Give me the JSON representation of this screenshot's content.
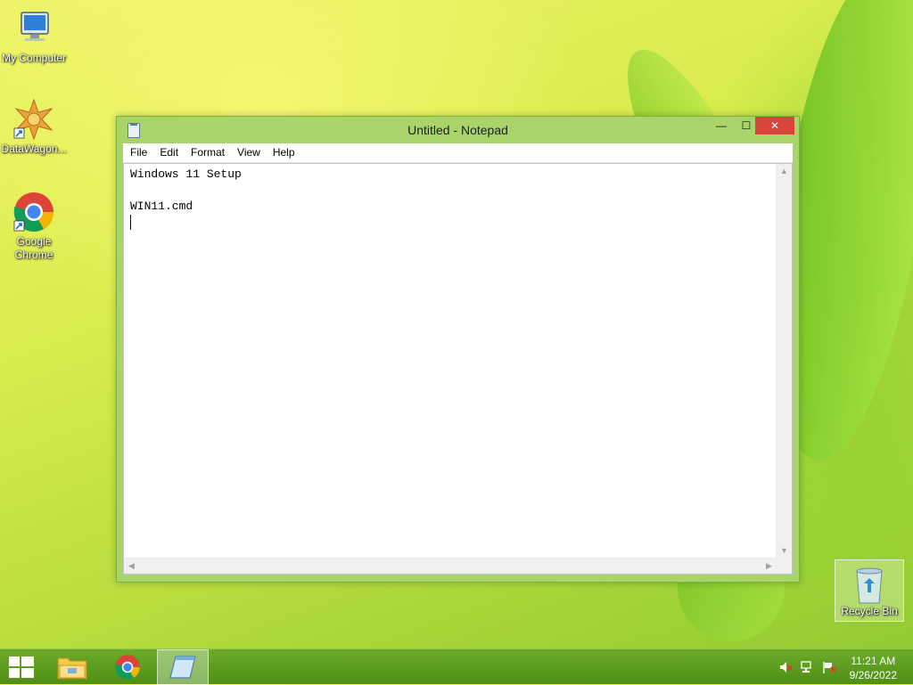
{
  "desktop": {
    "icons": [
      {
        "label": "My Computer"
      },
      {
        "label": "DataWagon..."
      },
      {
        "label": "Google Chrome"
      },
      {
        "label": "Recycle Bin"
      }
    ]
  },
  "window": {
    "title": "Untitled - Notepad",
    "controls": {
      "minimize": "—",
      "maximize": "☐",
      "close": "✕"
    },
    "menu": [
      "File",
      "Edit",
      "Format",
      "View",
      "Help"
    ],
    "content": {
      "lines": [
        "Windows 11 Setup",
        "",
        "WIN11.cmd",
        ""
      ]
    }
  },
  "taskbar": {
    "apps": [
      {
        "name": "file-explorer"
      },
      {
        "name": "google-chrome"
      },
      {
        "name": "notepad",
        "active": true
      }
    ],
    "clock": {
      "time": "11:21 AM",
      "date": "9/26/2022"
    }
  },
  "colors": {
    "accent": "#a8d46a",
    "close": "#d9453a",
    "taskbar": "#5a9a1e"
  }
}
